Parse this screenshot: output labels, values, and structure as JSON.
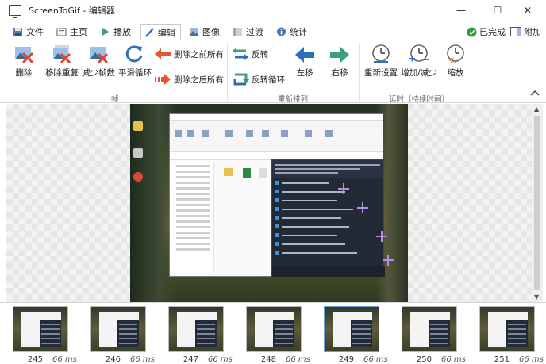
{
  "window": {
    "title": "ScreenToGif - 编辑器",
    "minimize_glyph": "—",
    "maximize_glyph": "☐",
    "close_glyph": "✕"
  },
  "tabs": [
    {
      "label": "文件",
      "icon": "save-icon"
    },
    {
      "label": "主页",
      "icon": "home-icon"
    },
    {
      "label": "播放",
      "icon": "play-icon"
    },
    {
      "label": "编辑",
      "icon": "pen-icon",
      "active": true
    },
    {
      "label": "图像",
      "icon": "image-icon"
    },
    {
      "label": "过渡",
      "icon": "transition-icon"
    },
    {
      "label": "统计",
      "icon": "info-icon"
    }
  ],
  "tabbar_right": {
    "done_label": "已完成",
    "attach_label": "附加"
  },
  "ribbon": {
    "frames_group": {
      "label": "帧",
      "delete": "删除",
      "remove_dup": "移除重复",
      "reduce": "减少帧数",
      "smooth_loop": "平滑循环",
      "delete_before": "删除之前所有",
      "delete_after": "删除之后所有"
    },
    "reorder_group": {
      "label": "重新排列",
      "reverse": "反转",
      "yoyo": "反转循环",
      "move_left": "左移",
      "move_right": "右移"
    },
    "delay_group": {
      "label": "延时（持续时间）",
      "override": "重新设置",
      "increase": "增加/减少",
      "scale": "缩放"
    }
  },
  "filmstrip": {
    "frames": [
      {
        "number": "245",
        "delay": "66 ms"
      },
      {
        "number": "246",
        "delay": "66 ms"
      },
      {
        "number": "247",
        "delay": "66 ms"
      },
      {
        "number": "248",
        "delay": "66 ms"
      },
      {
        "number": "249",
        "delay": "66 ms",
        "selected": true
      },
      {
        "number": "250",
        "delay": "66 ms"
      },
      {
        "number": "251",
        "delay": "66 ms"
      }
    ]
  },
  "colors": {
    "accent": "#1e6fc8",
    "delete_red": "#e0462e",
    "arrow_green": "#3aa27a",
    "arrow_blue": "#2f6fb8",
    "done_green": "#2e9b3f"
  }
}
